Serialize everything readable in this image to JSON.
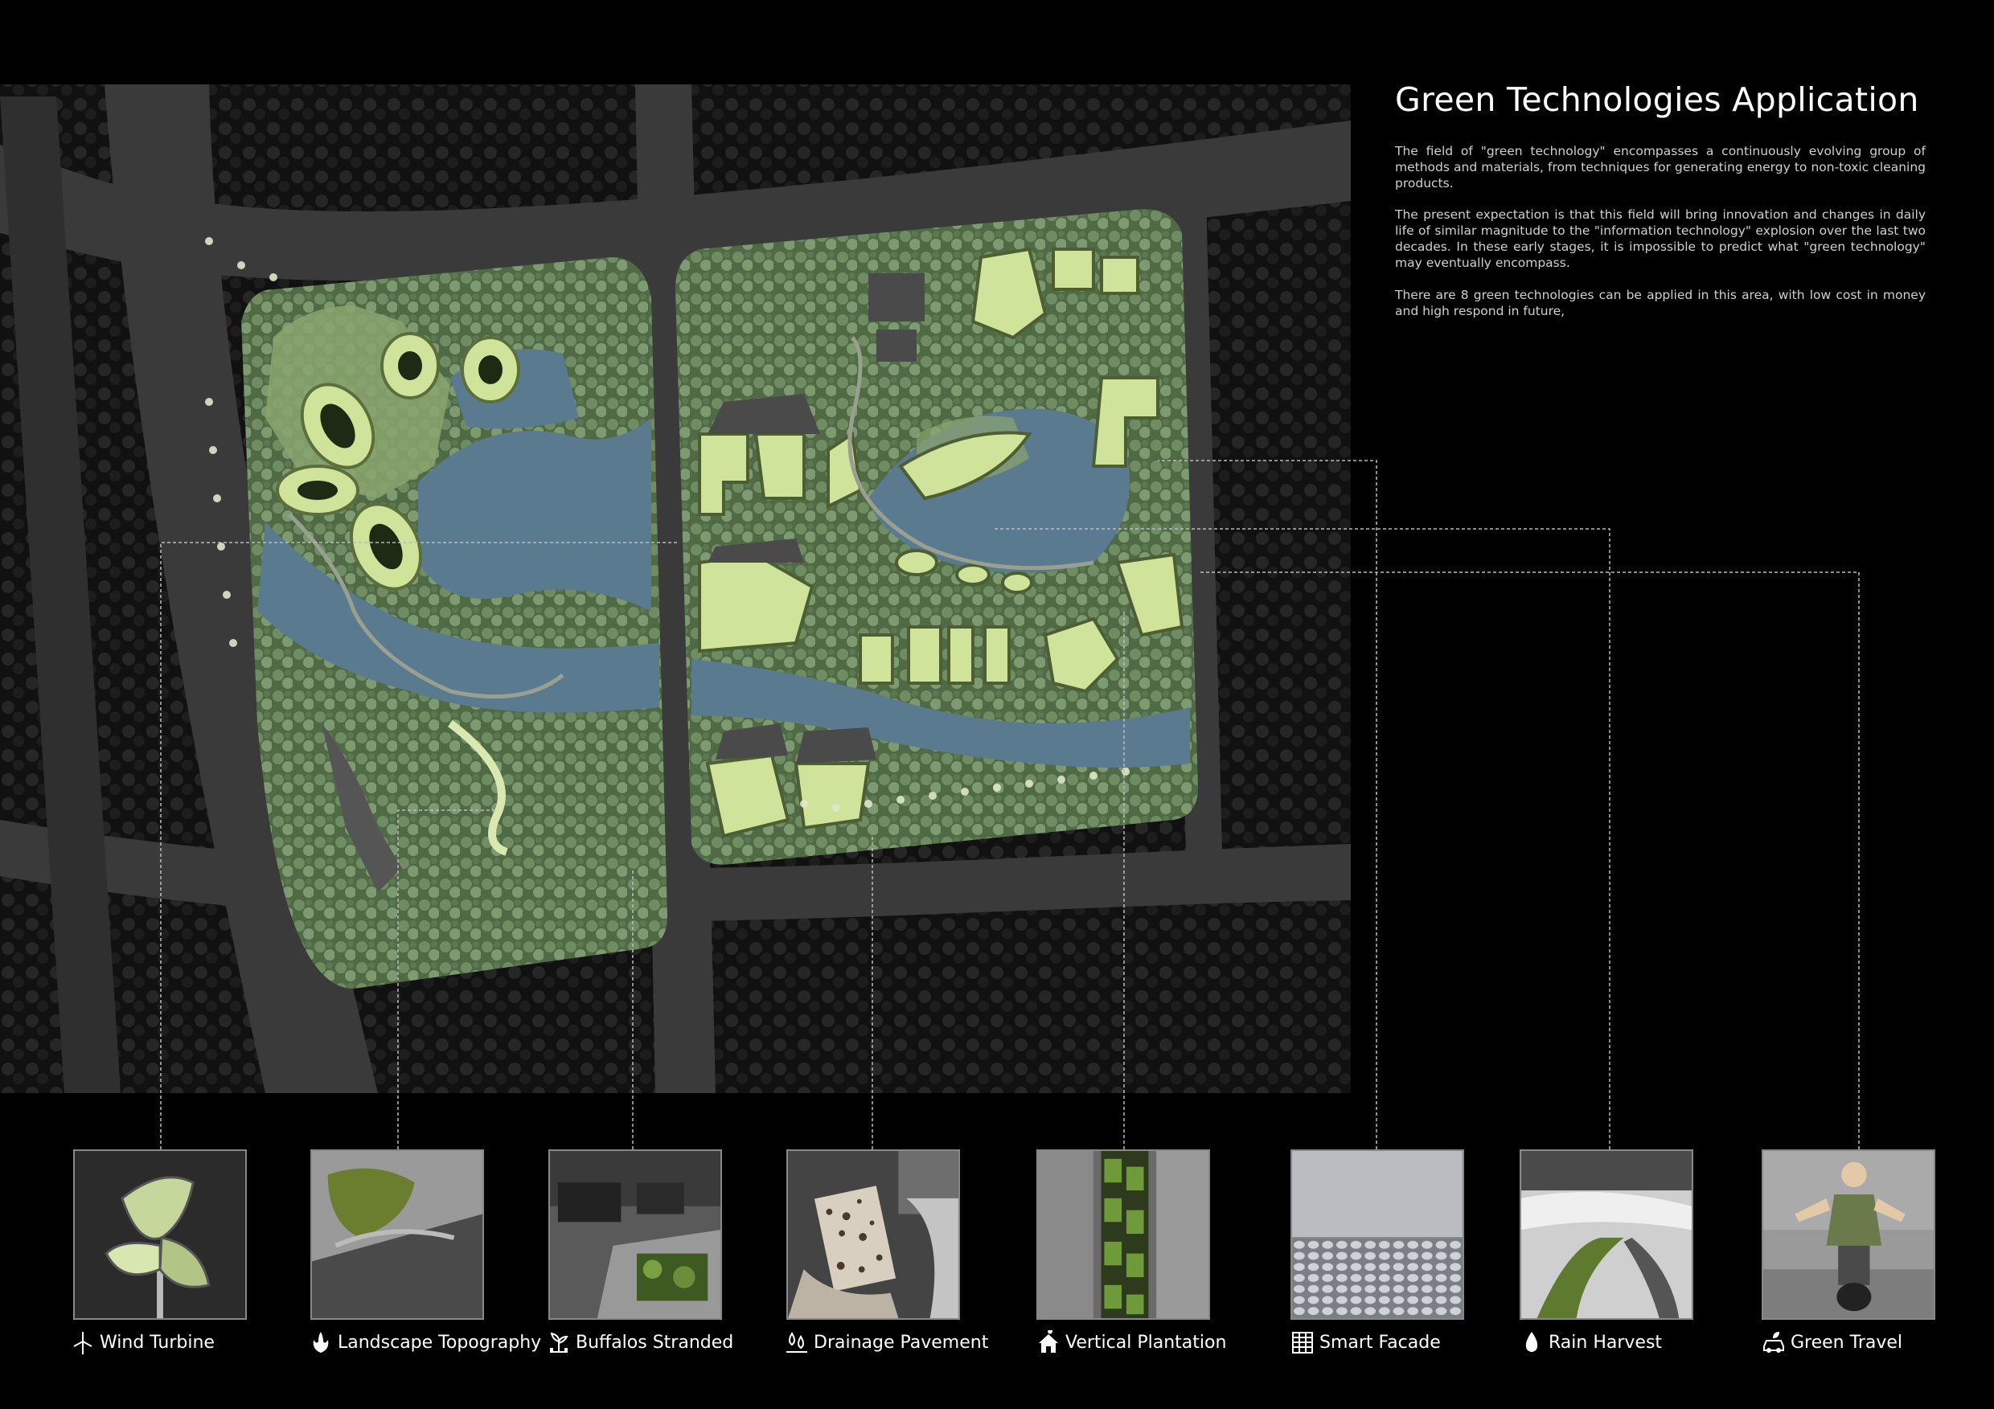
{
  "header": {
    "title": "Green Technologies Application"
  },
  "intro": {
    "paragraphs": [
      "The field of \"green technology\" encompasses a continuously evolving group of methods and materials, from techniques for generating energy to non-toxic cleaning products.",
      "The present expectation is that this field will bring innovation and changes in daily life of similar magnitude to the \"information technology\" explosion over the last two decades. In these early stages, it is impossible to predict what \"green technology\" may eventually encompass.",
      "There are 8 green technologies can be applied in this area, with low cost in money and high respond in future,"
    ]
  },
  "colors": {
    "background": "#000000",
    "road": "#3a3a3a",
    "water": "#5a7a8f",
    "lawn": "#6e8a55",
    "tree": "#8ea880",
    "building": "#cfe39a",
    "leader_line": "#bbbbbb"
  },
  "technologies": [
    {
      "label": "Wind Turbine",
      "icon": "wind-turbine-icon"
    },
    {
      "label": "Landscape Topography",
      "icon": "flame-leaf-icon"
    },
    {
      "label": "Buffalos Stranded",
      "icon": "sprout-icon"
    },
    {
      "label": "Drainage Pavement",
      "icon": "water-drops-icon"
    },
    {
      "label": "Vertical Plantation",
      "icon": "leaf-house-icon"
    },
    {
      "label": "Smart Facade",
      "icon": "grid-building-icon"
    },
    {
      "label": "Rain Harvest",
      "icon": "raindrop-icon"
    },
    {
      "label": "Green Travel",
      "icon": "car-leaf-icon"
    }
  ]
}
